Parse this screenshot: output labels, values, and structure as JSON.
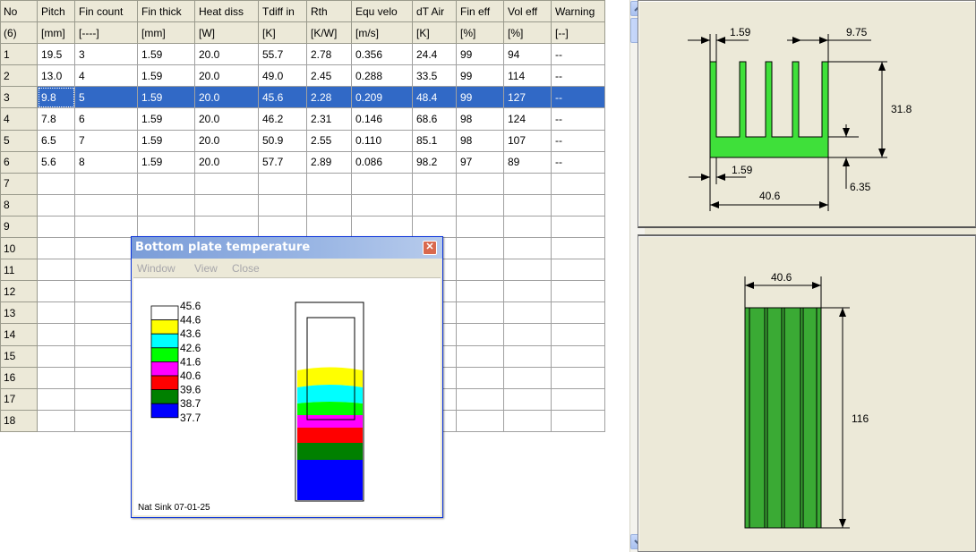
{
  "grid": {
    "headers": [
      "No",
      "Pitch",
      "Fin count",
      "Fin thick",
      "Heat diss",
      "Tdiff in",
      "Rth",
      "Equ velo",
      "dT Air",
      "Fin eff",
      "Vol eff",
      "Warning"
    ],
    "units": [
      "(6)",
      "[mm]",
      "[----]",
      "[mm]",
      "[W]",
      "[K]",
      "[K/W]",
      "[m/s]",
      "[K]",
      "[%]",
      "[%]",
      "[--]"
    ],
    "rows": [
      [
        "1",
        "19.5",
        "3",
        "1.59",
        "20.0",
        "55.7",
        "2.78",
        "0.356",
        "24.4",
        "99",
        "94",
        "--"
      ],
      [
        "2",
        "13.0",
        "4",
        "1.59",
        "20.0",
        "49.0",
        "2.45",
        "0.288",
        "33.5",
        "99",
        "114",
        "--"
      ],
      [
        "3",
        "9.8",
        "5",
        "1.59",
        "20.0",
        "45.6",
        "2.28",
        "0.209",
        "48.4",
        "99",
        "127",
        "--"
      ],
      [
        "4",
        "7.8",
        "6",
        "1.59",
        "20.0",
        "46.2",
        "2.31",
        "0.146",
        "68.6",
        "98",
        "124",
        "--"
      ],
      [
        "5",
        "6.5",
        "7",
        "1.59",
        "20.0",
        "50.9",
        "2.55",
        "0.110",
        "85.1",
        "98",
        "107",
        "--"
      ],
      [
        "6",
        "5.6",
        "8",
        "1.59",
        "20.0",
        "57.7",
        "2.89",
        "0.086",
        "98.2",
        "97",
        "89",
        "--"
      ],
      [
        "7",
        "",
        "",
        "",
        "",
        "",
        "",
        "",
        "",
        "",
        "",
        ""
      ],
      [
        "8",
        "",
        "",
        "",
        "",
        "",
        "",
        "",
        "",
        "",
        "",
        ""
      ],
      [
        "9",
        "",
        "",
        "",
        "",
        "",
        "",
        "",
        "",
        "",
        "",
        ""
      ],
      [
        "10",
        "",
        "",
        "",
        "",
        "",
        "",
        "",
        "",
        "",
        "",
        ""
      ],
      [
        "11",
        "",
        "",
        "",
        "",
        "",
        "",
        "",
        "",
        "",
        "",
        ""
      ],
      [
        "12",
        "",
        "",
        "",
        "",
        "",
        "",
        "",
        "",
        "",
        "",
        ""
      ],
      [
        "13",
        "",
        "",
        "",
        "",
        "",
        "",
        "",
        "",
        "",
        "",
        ""
      ],
      [
        "14",
        "",
        "",
        "",
        "",
        "",
        "",
        "",
        "",
        "",
        "",
        ""
      ],
      [
        "15",
        "",
        "",
        "",
        "",
        "",
        "",
        "",
        "",
        "",
        "",
        ""
      ],
      [
        "16",
        "",
        "",
        "",
        "",
        "",
        "",
        "",
        "",
        "",
        "",
        ""
      ],
      [
        "17",
        "",
        "",
        "",
        "",
        "",
        "",
        "",
        "",
        "",
        "",
        ""
      ],
      [
        "18",
        "",
        "",
        "",
        "",
        "",
        "",
        "",
        "",
        "",
        "",
        ""
      ]
    ],
    "selected_row": 3
  },
  "profile_drawing": {
    "fin_thick": "1.59",
    "gap": "9.75",
    "height": "31.8",
    "base_thick_label": "1.59",
    "base": "6.35",
    "width": "40.6"
  },
  "top_view_drawing": {
    "width": "40.6",
    "length": "116"
  },
  "popup": {
    "title": "Bottom plate temperature",
    "menu": [
      "Window",
      "View",
      "Close"
    ],
    "footer": "Nat Sink 07-01-25",
    "legend": [
      {
        "value": "45.6",
        "color": "#ffffff"
      },
      {
        "value": "44.6",
        "color": "#ffff00"
      },
      {
        "value": "43.6",
        "color": "#00ffff"
      },
      {
        "value": "42.6",
        "color": "#00ff00"
      },
      {
        "value": "41.6",
        "color": "#ff00ff"
      },
      {
        "value": "40.6",
        "color": "#ff0000"
      },
      {
        "value": "39.6",
        "color": "#008000"
      },
      {
        "value": "38.7",
        "color": "#0000ff"
      },
      {
        "value": "37.7",
        "color": ""
      }
    ]
  },
  "colors": {
    "selection": "#3169c6",
    "heatsink_fill": "#3fe03a",
    "heatsink_top": "#3aaa34"
  }
}
